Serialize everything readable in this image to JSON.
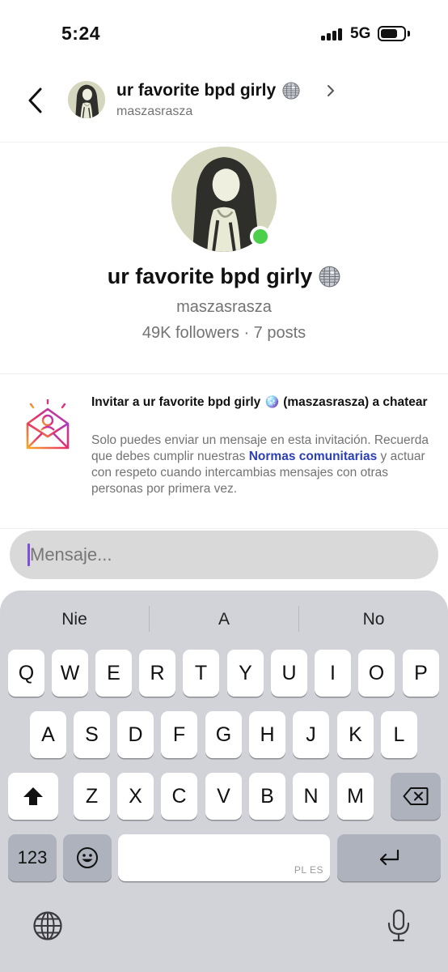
{
  "status_bar": {
    "time": "5:24",
    "network": "5G"
  },
  "header": {
    "name": "ur favorite bpd girly",
    "username": "maszasrasza"
  },
  "profile": {
    "name": "ur favorite bpd girly",
    "username": "maszasrasza",
    "stats": "49K followers · 7 posts"
  },
  "invite": {
    "title": "Invitar a ur favorite bpd girly 🪩 (maszasrasza) a chatear",
    "body_before": "Solo puedes enviar un mensaje en esta invitación. Recuerda que debes cumplir nuestras ",
    "link": "Normas comunitarias",
    "body_after": " y actuar con respeto cuando intercambias mensajes con otras personas por primera vez."
  },
  "message_input": {
    "placeholder": "Mensaje...",
    "value": ""
  },
  "keyboard": {
    "suggestions": [
      "Nie",
      "A",
      "No"
    ],
    "row1": [
      "Q",
      "W",
      "E",
      "R",
      "T",
      "Y",
      "U",
      "I",
      "O",
      "P"
    ],
    "row2": [
      "A",
      "S",
      "D",
      "F",
      "G",
      "H",
      "J",
      "K",
      "L"
    ],
    "row3": [
      "Z",
      "X",
      "C",
      "V",
      "B",
      "N",
      "M"
    ],
    "numbers_key": "123",
    "space_label": "PL ES"
  },
  "colors": {
    "online": "#4cd04c",
    "link": "#2a3fb8",
    "caret": "#7b4fe0",
    "keyboard_bg": "#d1d3d9"
  },
  "icons": [
    "back-arrow-icon",
    "disco-ball-icon",
    "chevron-right-icon",
    "invite-mail-icon",
    "shift-icon",
    "emoji-icon",
    "return-icon",
    "backspace-icon",
    "globe-icon",
    "microphone-icon"
  ]
}
